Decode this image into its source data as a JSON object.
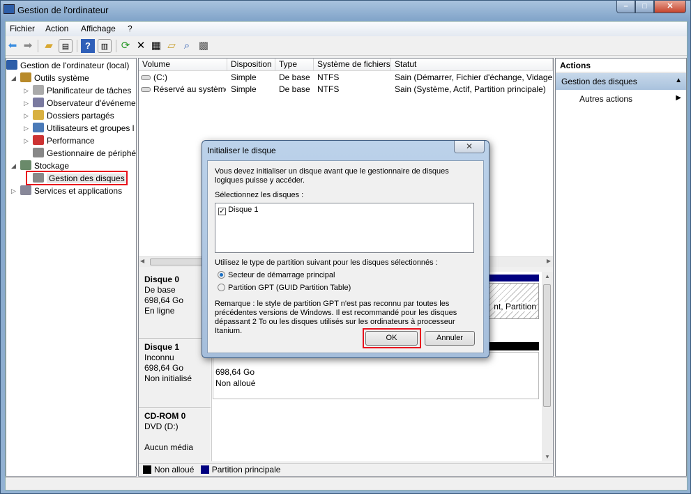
{
  "window": {
    "title": "Gestion de l'ordinateur",
    "controls": [
      "minimize",
      "maximize",
      "close"
    ]
  },
  "menu": [
    "Fichier",
    "Action",
    "Affichage",
    "?"
  ],
  "toolbar": [
    "back-icon",
    "forward-icon",
    "up-folder-icon",
    "show-hide-tree-icon",
    "help-icon",
    "show-hide-action-icon",
    "refresh-icon",
    "delete-icon",
    "properties-icon",
    "open-icon",
    "search-icon",
    "settings-icon"
  ],
  "tree": [
    {
      "label": "Gestion de l'ordinateur (local)",
      "level": 0,
      "expander": ""
    },
    {
      "label": "Outils système",
      "level": 1,
      "expander": "expanded"
    },
    {
      "label": "Planificateur de tâches",
      "level": 2,
      "expander": "collapsed"
    },
    {
      "label": "Observateur d'événeme",
      "level": 2,
      "expander": "collapsed"
    },
    {
      "label": "Dossiers partagés",
      "level": 2,
      "expander": "collapsed"
    },
    {
      "label": "Utilisateurs et groupes l",
      "level": 2,
      "expander": "collapsed"
    },
    {
      "label": "Performance",
      "level": 2,
      "expander": "collapsed"
    },
    {
      "label": "Gestionnaire de périphé",
      "level": 2,
      "expander": ""
    },
    {
      "label": "Stockage",
      "level": 1,
      "expander": "expanded"
    },
    {
      "label": "Gestion des disques",
      "level": 2,
      "expander": "",
      "selected": true
    },
    {
      "label": "Services et applications",
      "level": 1,
      "expander": "collapsed"
    }
  ],
  "volumes": {
    "columns": [
      "Volume",
      "Disposition",
      "Type",
      "Système de fichiers",
      "Statut"
    ],
    "rows": [
      [
        "(C:)",
        "Simple",
        "De base",
        "NTFS",
        "Sain (Démarrer, Fichier d'échange, Vidage s"
      ],
      [
        "Réservé au système",
        "Simple",
        "De base",
        "NTFS",
        "Sain (Système, Actif, Partition principale)"
      ]
    ]
  },
  "disks": [
    {
      "name": "Disque 0",
      "type": "De base",
      "size": "698,64 Go",
      "status": "En ligne",
      "partition_text": "nt, Partition"
    },
    {
      "name": "Disque 1",
      "type": "Inconnu",
      "size": "698,64 Go",
      "status": "Non initialisé",
      "partition_size": "698,64 Go",
      "partition_status": "Non alloué"
    },
    {
      "name": "CD-ROM 0",
      "type": "DVD (D:)",
      "status": "Aucun média"
    }
  ],
  "legend": [
    {
      "label": "Non alloué",
      "color": "#000000"
    },
    {
      "label": "Partition principale",
      "color": "#000080"
    }
  ],
  "actions": {
    "header": "Actions",
    "section": "Gestion des disques",
    "item": "Autres actions"
  },
  "dialog": {
    "title": "Initialiser le disque",
    "intro": "Vous devez initialiser un disque avant que le gestionnaire de disques logiques puisse y accéder.",
    "select_label": "Sélectionnez les disques :",
    "disks": [
      {
        "label": "Disque 1",
        "checked": true
      }
    ],
    "partition_label": "Utilisez le type de partition suivant pour les disques sélectionnés :",
    "options": [
      {
        "label": "Secteur de démarrage principal",
        "selected": true
      },
      {
        "label": "Partition GPT (GUID Partition Table)",
        "selected": false
      }
    ],
    "note": "Remarque : le style de partition GPT n'est pas reconnu par toutes les précédentes versions de Windows. Il est recommandé pour les disques dépassant 2 To ou les disques utilisés sur les ordinateurs à processeur Itanium.",
    "ok": "OK",
    "cancel": "Annuler"
  },
  "colors": {
    "highlight": "#e8111d",
    "partition_primary": "#000080",
    "unallocated": "#000000"
  }
}
